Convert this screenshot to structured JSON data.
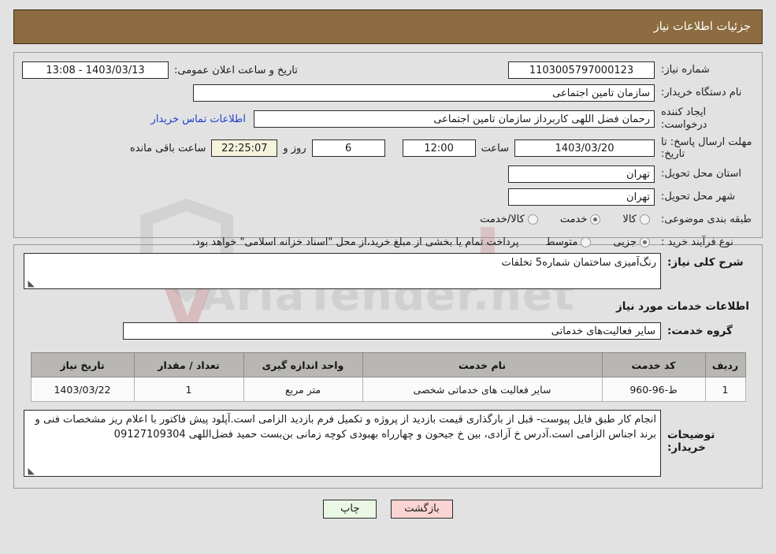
{
  "header": {
    "title": "جزئیات اطلاعات نیاز"
  },
  "watermark": {
    "text": "AriaTender.net"
  },
  "top_form": {
    "need_number_label": "شماره نیاز:",
    "need_number_value": "1103005797000123",
    "buyer_org_label": "نام دستگاه خریدار:",
    "buyer_org_value": "سازمان تامین اجتماعی",
    "requester_label": "ایجاد کننده درخواست:",
    "requester_value": "رحمان فضل اللهی کاربرداز سازمان تامین اجتماعی",
    "deadline_label": "مهلت ارسال پاسخ: تا تاریخ:",
    "deadline_date": "1403/03/20",
    "hour_label": "ساعت",
    "deadline_time": "12:00",
    "days_remaining": "6",
    "days_label": "روز و",
    "clock_remaining": "22:25:07",
    "remaining_suffix_label": "ساعت باقی مانده",
    "publish_label": "تاریخ و ساعت اعلان عمومی:",
    "publish_value": "1403/03/13 - 13:08",
    "contact_link": "اطلاعات تماس خریدار",
    "province_label": "استان محل تحویل:",
    "province_value": "تهران",
    "city_label": "شهر محل تحویل:",
    "city_value": "تهران",
    "category_label": "طبقه بندی موضوعی:",
    "category_options": [
      {
        "label": "کالا",
        "selected": false
      },
      {
        "label": "خدمت",
        "selected": true
      },
      {
        "label": "کالا/خدمت",
        "selected": false
      }
    ],
    "process_label": "نوع فرآیند خرید :",
    "process_options": [
      {
        "label": "جزیی",
        "selected": true
      },
      {
        "label": "متوسط",
        "selected": false
      }
    ],
    "process_note": "پرداخت تمام یا بخشی از مبلغ خرید،از محل \"اسناد خزانه اسلامی\" خواهد بود."
  },
  "middle": {
    "need_desc_label": "شرح کلی نیاز:",
    "need_desc_value": "رنگ‌آمیزی ساختمان شماره5 تخلفات",
    "services_section_title": "اطلاعات خدمات مورد نیاز",
    "service_group_label": "گروه خدمت:",
    "service_group_value": "سایر فعالیت‌های خدماتی",
    "table": {
      "columns": [
        "ردیف",
        "کد خدمت",
        "نام خدمت",
        "واحد اندازه گیری",
        "تعداد / مقدار",
        "تاریخ نیاز"
      ],
      "rows": [
        {
          "row_no": "1",
          "service_code": "ط-96-960",
          "service_name": "سایر فعالیت های خدماتی شخصی",
          "unit": "متر مربع",
          "quantity": "1",
          "need_date": "1403/03/22"
        }
      ]
    },
    "buyer_notes_label": "توضیحات خریدار:",
    "buyer_notes_value": "انجام کار طبق فایل پیوست- قبل از بارگذاری قیمت بازدید از پروژه و تکمیل فرم بازدید الزامی است.آپلود پیش فاکتور با اعلام ریز مشخصات فنی و برند اجناس الزامی است.آدرس خ آزادی، بین خ جیحون و چهارراه بهبودی کوچه زمانی بن‌بست حمید فضل‌اللهی 09127109304"
  },
  "footer": {
    "print_button": "چاپ",
    "back_button": "بازگشت"
  }
}
